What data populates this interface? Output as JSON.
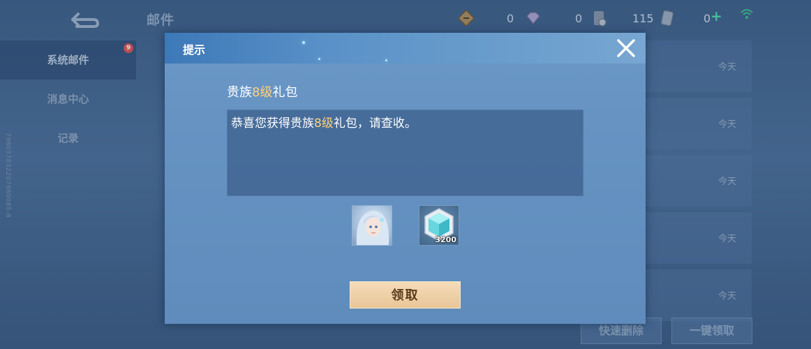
{
  "header": {
    "title": "邮件",
    "currencies": [
      {
        "icon": "scroll-icon",
        "value": "0"
      },
      {
        "icon": "diamond-icon",
        "value": "0"
      },
      {
        "icon": "coin-icon",
        "value": "115"
      },
      {
        "icon": "voucher-icon",
        "value": "0"
      }
    ],
    "plus": "+"
  },
  "sidebar": {
    "items": [
      {
        "label": "系统邮件",
        "badge": "9",
        "active": true
      },
      {
        "label": "消息中心"
      },
      {
        "label": "记录"
      }
    ],
    "id_text": "796037832207980085-8"
  },
  "mail_list": {
    "dates": [
      "今天",
      "今天",
      "今天",
      "今天",
      "今天"
    ]
  },
  "bottom_buttons": {
    "quick_delete": "快速删除",
    "claim_all": "一键领取"
  },
  "modal": {
    "title": "提示",
    "gift_prefix": "贵族",
    "gift_level": "8级",
    "gift_suffix": "礼包",
    "message_prefix": "恭喜您获得贵族",
    "message_level": "8级",
    "message_suffix": "礼包，请查收。",
    "items": [
      {
        "icon": "hero-avatar-icon",
        "qty": ""
      },
      {
        "icon": "crystal-icon",
        "qty": "3200"
      }
    ],
    "claim_label": "领取",
    "colors": {
      "highlight": "#ffd27a",
      "button": "#e8c698"
    }
  }
}
